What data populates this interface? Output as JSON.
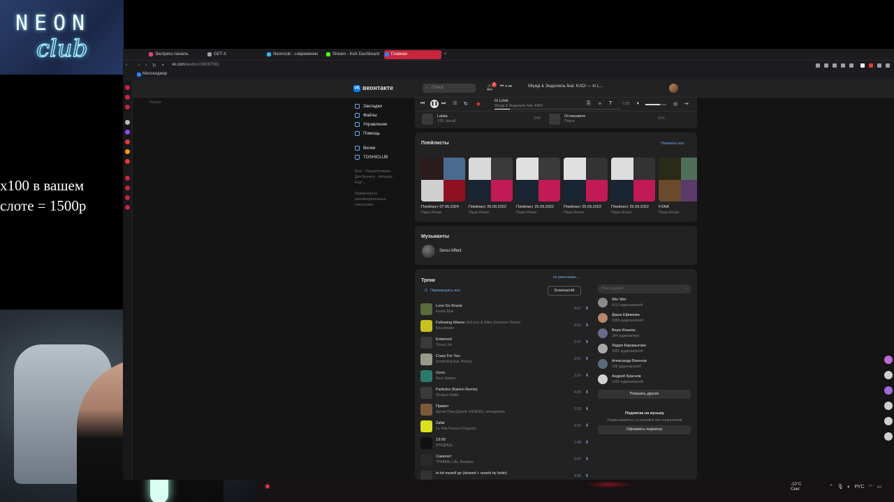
{
  "overlay": {
    "logo_top": "NEON",
    "logo_bottom": "club",
    "promo_line1": "х100 в вашем",
    "promo_line2": "слоте = 1500р"
  },
  "browser": {
    "tabs": [
      {
        "label": "Экспресс-панель",
        "color": "#e0436a"
      },
      {
        "label": "GET-X",
        "color": "#9aa0a6"
      },
      {
        "label": "Neonclub - современно",
        "color": "#29b6f6"
      },
      {
        "label": "Stream - Kick Dashboard",
        "color": "#53fc18"
      },
      {
        "label": "Главная",
        "color": "#2f80ff"
      }
    ],
    "url_host": "vk.com",
    "url_path": "/audios156067981",
    "bookmark": "Мессенджер"
  },
  "vk": {
    "logo": "вконтакте",
    "search_placeholder": "Поиск",
    "notification_count": "1",
    "header_track": "Miyagi & Эндшпиль feat. KADI — In L...",
    "left_nav": [
      {
        "label": "Закладки"
      },
      {
        "label": "Файлы"
      },
      {
        "label": "Управление"
      },
      {
        "label": "Помощь"
      }
    ],
    "left_nav2": [
      {
        "label": "Вилки"
      },
      {
        "label": "TOSHICLUB"
      }
    ],
    "footer_links": "Блог · Разработчикам · Для бизнеса · Авторам · Ещё ⌄",
    "footer_note": "Применяются рекомендательные технологии",
    "drafts": "Наверх"
  },
  "player": {
    "title": "In Love",
    "artist": "Miyagi & Эндшпиль feat. KADI",
    "progress": 0.12,
    "time": "-1:55",
    "volume": 0.7
  },
  "recent": [
    {
      "title": "Lalala",
      "artist": "Y2K, bbno$",
      "duration": "2:40"
    },
    {
      "title": "Остановите",
      "artist": "Перси",
      "duration": "3:47"
    }
  ],
  "playlists": {
    "title": "Плейлисты",
    "show_all": "Показать все",
    "items": [
      {
        "title": "Плейлист 07.06.2024",
        "owner": "Паша Ильин",
        "colors": [
          "#2a1c1c",
          "#4a6a8f",
          "#cfcfcf",
          "#8f1020"
        ]
      },
      {
        "title": "Плейлист 25.09.2022",
        "owner": "Паша Ильин",
        "colors": [
          "#d9d9d9",
          "#3a3a3a",
          "#1a2533",
          "#c21a55"
        ]
      },
      {
        "title": "Плейлист 25.09.2022",
        "owner": "Паша Ильин",
        "colors": [
          "#e0e0e0",
          "#3a3a3a",
          "#1a2533",
          "#c21a55"
        ]
      },
      {
        "title": "Плейлист 25.09.2022",
        "owner": "Паша Ильин",
        "colors": [
          "#e0e0e0",
          "#333",
          "#1a2533",
          "#c21a55"
        ]
      },
      {
        "title": "Плейлист 25.09.2022",
        "owner": "Паша Ильин",
        "colors": [
          "#dcdcdc",
          "#333",
          "#1a2533",
          "#c21a55"
        ]
      },
      {
        "title": "FONK",
        "owner": "Паша Ильин",
        "colors": [
          "#2a2a18",
          "#4f6f5a",
          "#6a4a2a",
          "#5a3a6a"
        ]
      }
    ]
  },
  "musicians": {
    "title": "Музыканты",
    "name": "Sensi Affect"
  },
  "tracks": {
    "title": "Треки",
    "sort": "по умолчанию ⌄",
    "shuffle": "Перемешать все",
    "download_all": "Download All",
    "items": [
      {
        "title": "Love Go Krazie",
        "feat": "",
        "artist": "Krazie Blue",
        "duration": "4:07",
        "color": "#5a6a3a"
      },
      {
        "title": "Following Waves",
        "feat": " VeiLove & Mike Emerson Remix",
        "artist": "Nico Antalic",
        "duration": "4:56",
        "color": "#c8c020"
      },
      {
        "title": "Entwined",
        "feat": "",
        "artist": "Ocean Jet",
        "duration": "2:37",
        "color": "#3a3a3a"
      },
      {
        "title": "Crazy For You",
        "feat": "",
        "artist": "Zonderling feat. Bishop",
        "duration": "2:51",
        "color": "#9a9a8a"
      },
      {
        "title": "Ozon",
        "feat": "",
        "artist": "Nuur Garaev",
        "duration": "3:16",
        "color": "#2a7a6a"
      },
      {
        "title": "Particles (Karton Remix)",
        "feat": "",
        "artist": "Shotgun Radio",
        "duration": "4:28",
        "color": "#3a3a3a"
      },
      {
        "title": "Привет",
        "feat": "",
        "artist": "Артем Пора Домой, FADE931, strangeeeee",
        "duration": "3:29",
        "color": "#7a5a3a"
      },
      {
        "title": "Zafar",
        "feat": "",
        "artist": "La Vela Puerca (Uruguay)",
        "duration": "4:22",
        "color": "#d8e020"
      },
      {
        "title": "19:99",
        "feat": "",
        "artist": "БРЕДИЦЬ",
        "duration": "1:48",
        "color": "#111111"
      },
      {
        "title": "Самолет",
        "feat": "",
        "artist": "ТРАВМА, Lillo, Валерис",
        "duration": "2:47",
        "color": "#2a2a2a"
      },
      {
        "title": "to let myself go (slowed + reverb by botin)",
        "feat": "",
        "artist": "",
        "duration": "4:35",
        "color": "#333"
      }
    ]
  },
  "friends": {
    "search_placeholder": "Поиск друзей",
    "items": [
      {
        "name": "Win Win",
        "count": "4112 аудиозаписей",
        "color": "#8a8a8a"
      },
      {
        "name": "Даша Ефимова",
        "count": "3655 аудиозаписей",
        "color": "#b8866a"
      },
      {
        "name": "Вера Ильина",
        "count": "394 аудиозаписи",
        "color": "#6a6a8a"
      },
      {
        "name": "Лидия Барамыгова",
        "count": "2555 аудиозаписей",
        "color": "#a8a8a8"
      },
      {
        "name": "Александр Вагенов",
        "count": "158 аудиозаписей",
        "color": "#5a6a7a"
      },
      {
        "name": "Андрей Краснов",
        "count": "1435 аудиозаписей",
        "color": "#d0d0d0"
      }
    ],
    "show_others": "Показать других",
    "sub_title": "Подписка на музыку",
    "sub_text": "Подписывайтесь и слушайте без ограничений",
    "sub_button": "Оформить подписку"
  },
  "taskbar": {
    "temp": "-10°C",
    "weather": "Снег",
    "lang": "РУС"
  }
}
